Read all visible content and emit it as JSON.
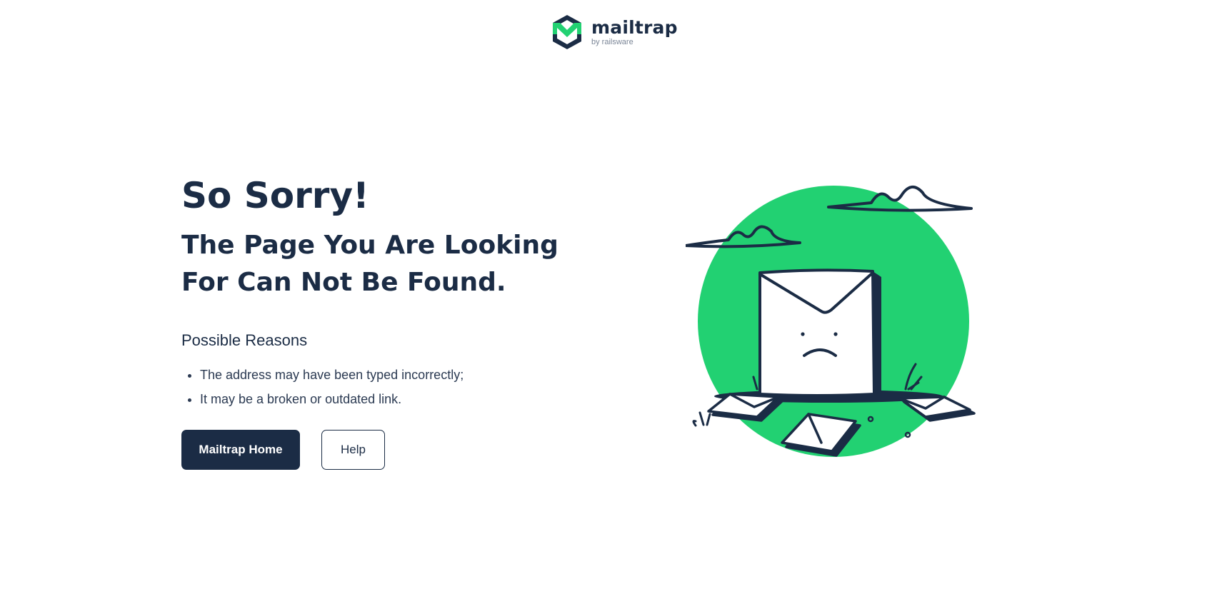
{
  "header": {
    "logo": {
      "name": "mailtrap",
      "tagline": "by railsware",
      "accent_color": "#22d172",
      "dark_color": "#1b2c45"
    }
  },
  "main": {
    "title": "So Sorry!",
    "subtitle": "The Page You Are Looking For Can Not Be Found.",
    "reasons_title": "Possible Reasons",
    "reasons": [
      "The address may have been typed incorrectly;",
      "It may be a broken or outdated link."
    ],
    "buttons": {
      "home_label": "Mailtrap Home",
      "help_label": "Help"
    }
  },
  "illustration": {
    "icon": "sad-envelope-illustration",
    "circle_color": "#22d172",
    "line_color": "#1b2c45"
  }
}
